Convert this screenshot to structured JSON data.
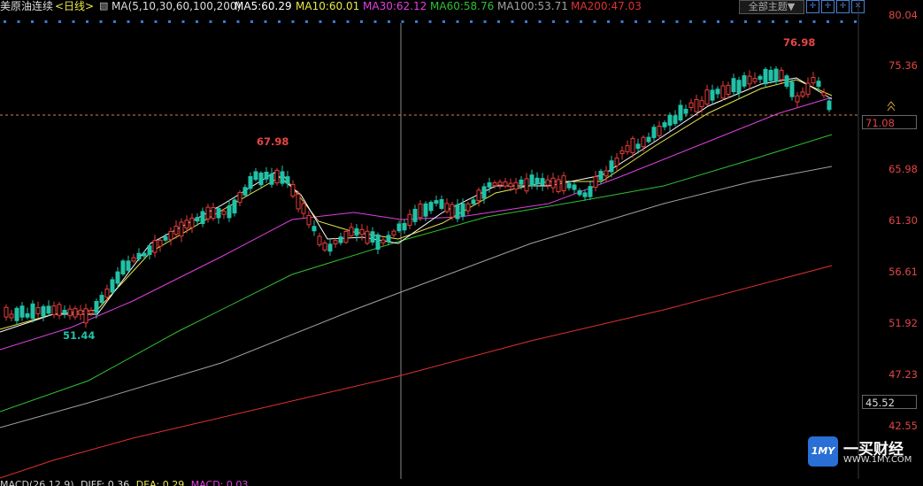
{
  "header": {
    "title": "美原油连续",
    "period": "<日线>",
    "ma_params": "MA(5,10,30,60,100,200)",
    "ma5": "MA5:60.29",
    "ma10": "MA10:60.01",
    "ma30": "MA30:62.12",
    "ma60": "MA60:58.76",
    "ma100": "MA100:53.71",
    "ma200": "MA200:47.03",
    "theme_button": "全部主题▼",
    "colors": {
      "ma5": "#ffffff",
      "ma10": "#e8e84a",
      "ma30": "#e040e0",
      "ma60": "#30c030",
      "ma100": "#a0a0a0",
      "ma200": "#e03030",
      "up": "#e83c3c",
      "down": "#20c2a8"
    }
  },
  "price_scale": [
    "80.04",
    "75.36",
    "71.08",
    "65.98",
    "61.30",
    "56.61",
    "51.92",
    "47.23",
    "45.52",
    "42.55"
  ],
  "current_price_label": "71.08",
  "crosshair_price_label": "45.52",
  "annotations": {
    "high_1": "67.98",
    "high_2": "76.98",
    "low_1": "51.44"
  },
  "bottom_indicator": {
    "name": "MACD(26,12,9)",
    "dif": "DIFF: 0.36",
    "dea": "DEA: 0.29",
    "macd": "MACD: 0.03"
  },
  "watermark": {
    "name": "一买财经",
    "url": "WWW.1MY.COM",
    "badge": "1MY"
  },
  "chart_data": {
    "type": "candlestick",
    "title": "美原油连续<日线>",
    "ylim": [
      42.55,
      80.04
    ],
    "high_marks": [
      67.98,
      76.98
    ],
    "low_marks": [
      51.44
    ],
    "series": [
      {
        "name": "MA5",
        "value": 60.29
      },
      {
        "name": "MA10",
        "value": 60.01
      },
      {
        "name": "MA30",
        "value": 62.12
      },
      {
        "name": "MA60",
        "value": 58.76
      },
      {
        "name": "MA100",
        "value": 53.71
      },
      {
        "name": "MA200",
        "value": 47.03
      }
    ]
  }
}
